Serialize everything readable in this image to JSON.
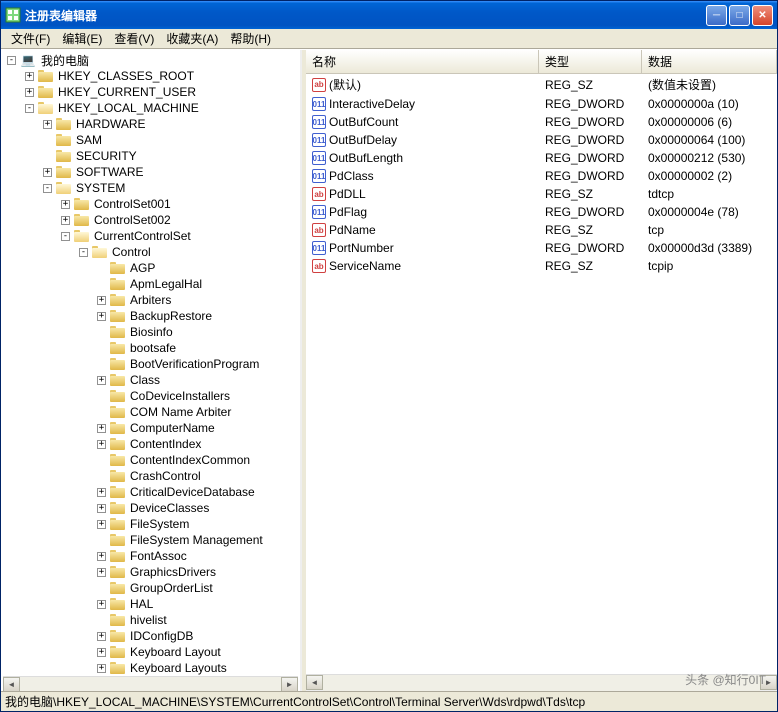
{
  "window": {
    "title": "注册表编辑器"
  },
  "menu": {
    "file": "文件(F)",
    "edit": "编辑(E)",
    "view": "查看(V)",
    "favorites": "收藏夹(A)",
    "help": "帮助(H)"
  },
  "tree": {
    "root": "我的电脑",
    "hkcr": "HKEY_CLASSES_ROOT",
    "hkcu": "HKEY_CURRENT_USER",
    "hklm": "HKEY_LOCAL_MACHINE",
    "hardware": "HARDWARE",
    "sam": "SAM",
    "security": "SECURITY",
    "software": "SOFTWARE",
    "system": "SYSTEM",
    "cs001": "ControlSet001",
    "cs002": "ControlSet002",
    "ccs": "CurrentControlSet",
    "control": "Control",
    "items": [
      {
        "label": "AGP",
        "exp": false
      },
      {
        "label": "ApmLegalHal",
        "exp": false
      },
      {
        "label": "Arbiters",
        "exp": true
      },
      {
        "label": "BackupRestore",
        "exp": true
      },
      {
        "label": "Biosinfo",
        "exp": false
      },
      {
        "label": "bootsafe",
        "exp": false
      },
      {
        "label": "BootVerificationProgram",
        "exp": false
      },
      {
        "label": "Class",
        "exp": true
      },
      {
        "label": "CoDeviceInstallers",
        "exp": false
      },
      {
        "label": "COM Name Arbiter",
        "exp": false
      },
      {
        "label": "ComputerName",
        "exp": true
      },
      {
        "label": "ContentIndex",
        "exp": true
      },
      {
        "label": "ContentIndexCommon",
        "exp": false
      },
      {
        "label": "CrashControl",
        "exp": false
      },
      {
        "label": "CriticalDeviceDatabase",
        "exp": true
      },
      {
        "label": "DeviceClasses",
        "exp": true
      },
      {
        "label": "FileSystem",
        "exp": true
      },
      {
        "label": "FileSystem Management",
        "exp": false
      },
      {
        "label": "FontAssoc",
        "exp": true
      },
      {
        "label": "GraphicsDrivers",
        "exp": true
      },
      {
        "label": "GroupOrderList",
        "exp": false
      },
      {
        "label": "HAL",
        "exp": true
      },
      {
        "label": "hivelist",
        "exp": false
      },
      {
        "label": "IDConfigDB",
        "exp": true
      },
      {
        "label": "Keyboard Layout",
        "exp": true
      },
      {
        "label": "Keyboard Layouts",
        "exp": true
      }
    ]
  },
  "list": {
    "headers": {
      "name": "名称",
      "type": "类型",
      "data": "数据"
    },
    "rows": [
      {
        "icon": "sz",
        "name": "(默认)",
        "type": "REG_SZ",
        "data": "(数值未设置)"
      },
      {
        "icon": "dw",
        "name": "InteractiveDelay",
        "type": "REG_DWORD",
        "data": "0x0000000a (10)"
      },
      {
        "icon": "dw",
        "name": "OutBufCount",
        "type": "REG_DWORD",
        "data": "0x00000006 (6)"
      },
      {
        "icon": "dw",
        "name": "OutBufDelay",
        "type": "REG_DWORD",
        "data": "0x00000064 (100)"
      },
      {
        "icon": "dw",
        "name": "OutBufLength",
        "type": "REG_DWORD",
        "data": "0x00000212 (530)"
      },
      {
        "icon": "dw",
        "name": "PdClass",
        "type": "REG_DWORD",
        "data": "0x00000002 (2)"
      },
      {
        "icon": "sz",
        "name": "PdDLL",
        "type": "REG_SZ",
        "data": "tdtcp"
      },
      {
        "icon": "dw",
        "name": "PdFlag",
        "type": "REG_DWORD",
        "data": "0x0000004e (78)"
      },
      {
        "icon": "sz",
        "name": "PdName",
        "type": "REG_SZ",
        "data": "tcp"
      },
      {
        "icon": "dw",
        "name": "PortNumber",
        "type": "REG_DWORD",
        "data": "0x00000d3d (3389)"
      },
      {
        "icon": "sz",
        "name": "ServiceName",
        "type": "REG_SZ",
        "data": "tcpip"
      }
    ]
  },
  "statusbar": "我的电脑\\HKEY_LOCAL_MACHINE\\SYSTEM\\CurrentControlSet\\Control\\Terminal Server\\Wds\\rdpwd\\Tds\\tcp",
  "watermark": "头条 @知行0IT"
}
